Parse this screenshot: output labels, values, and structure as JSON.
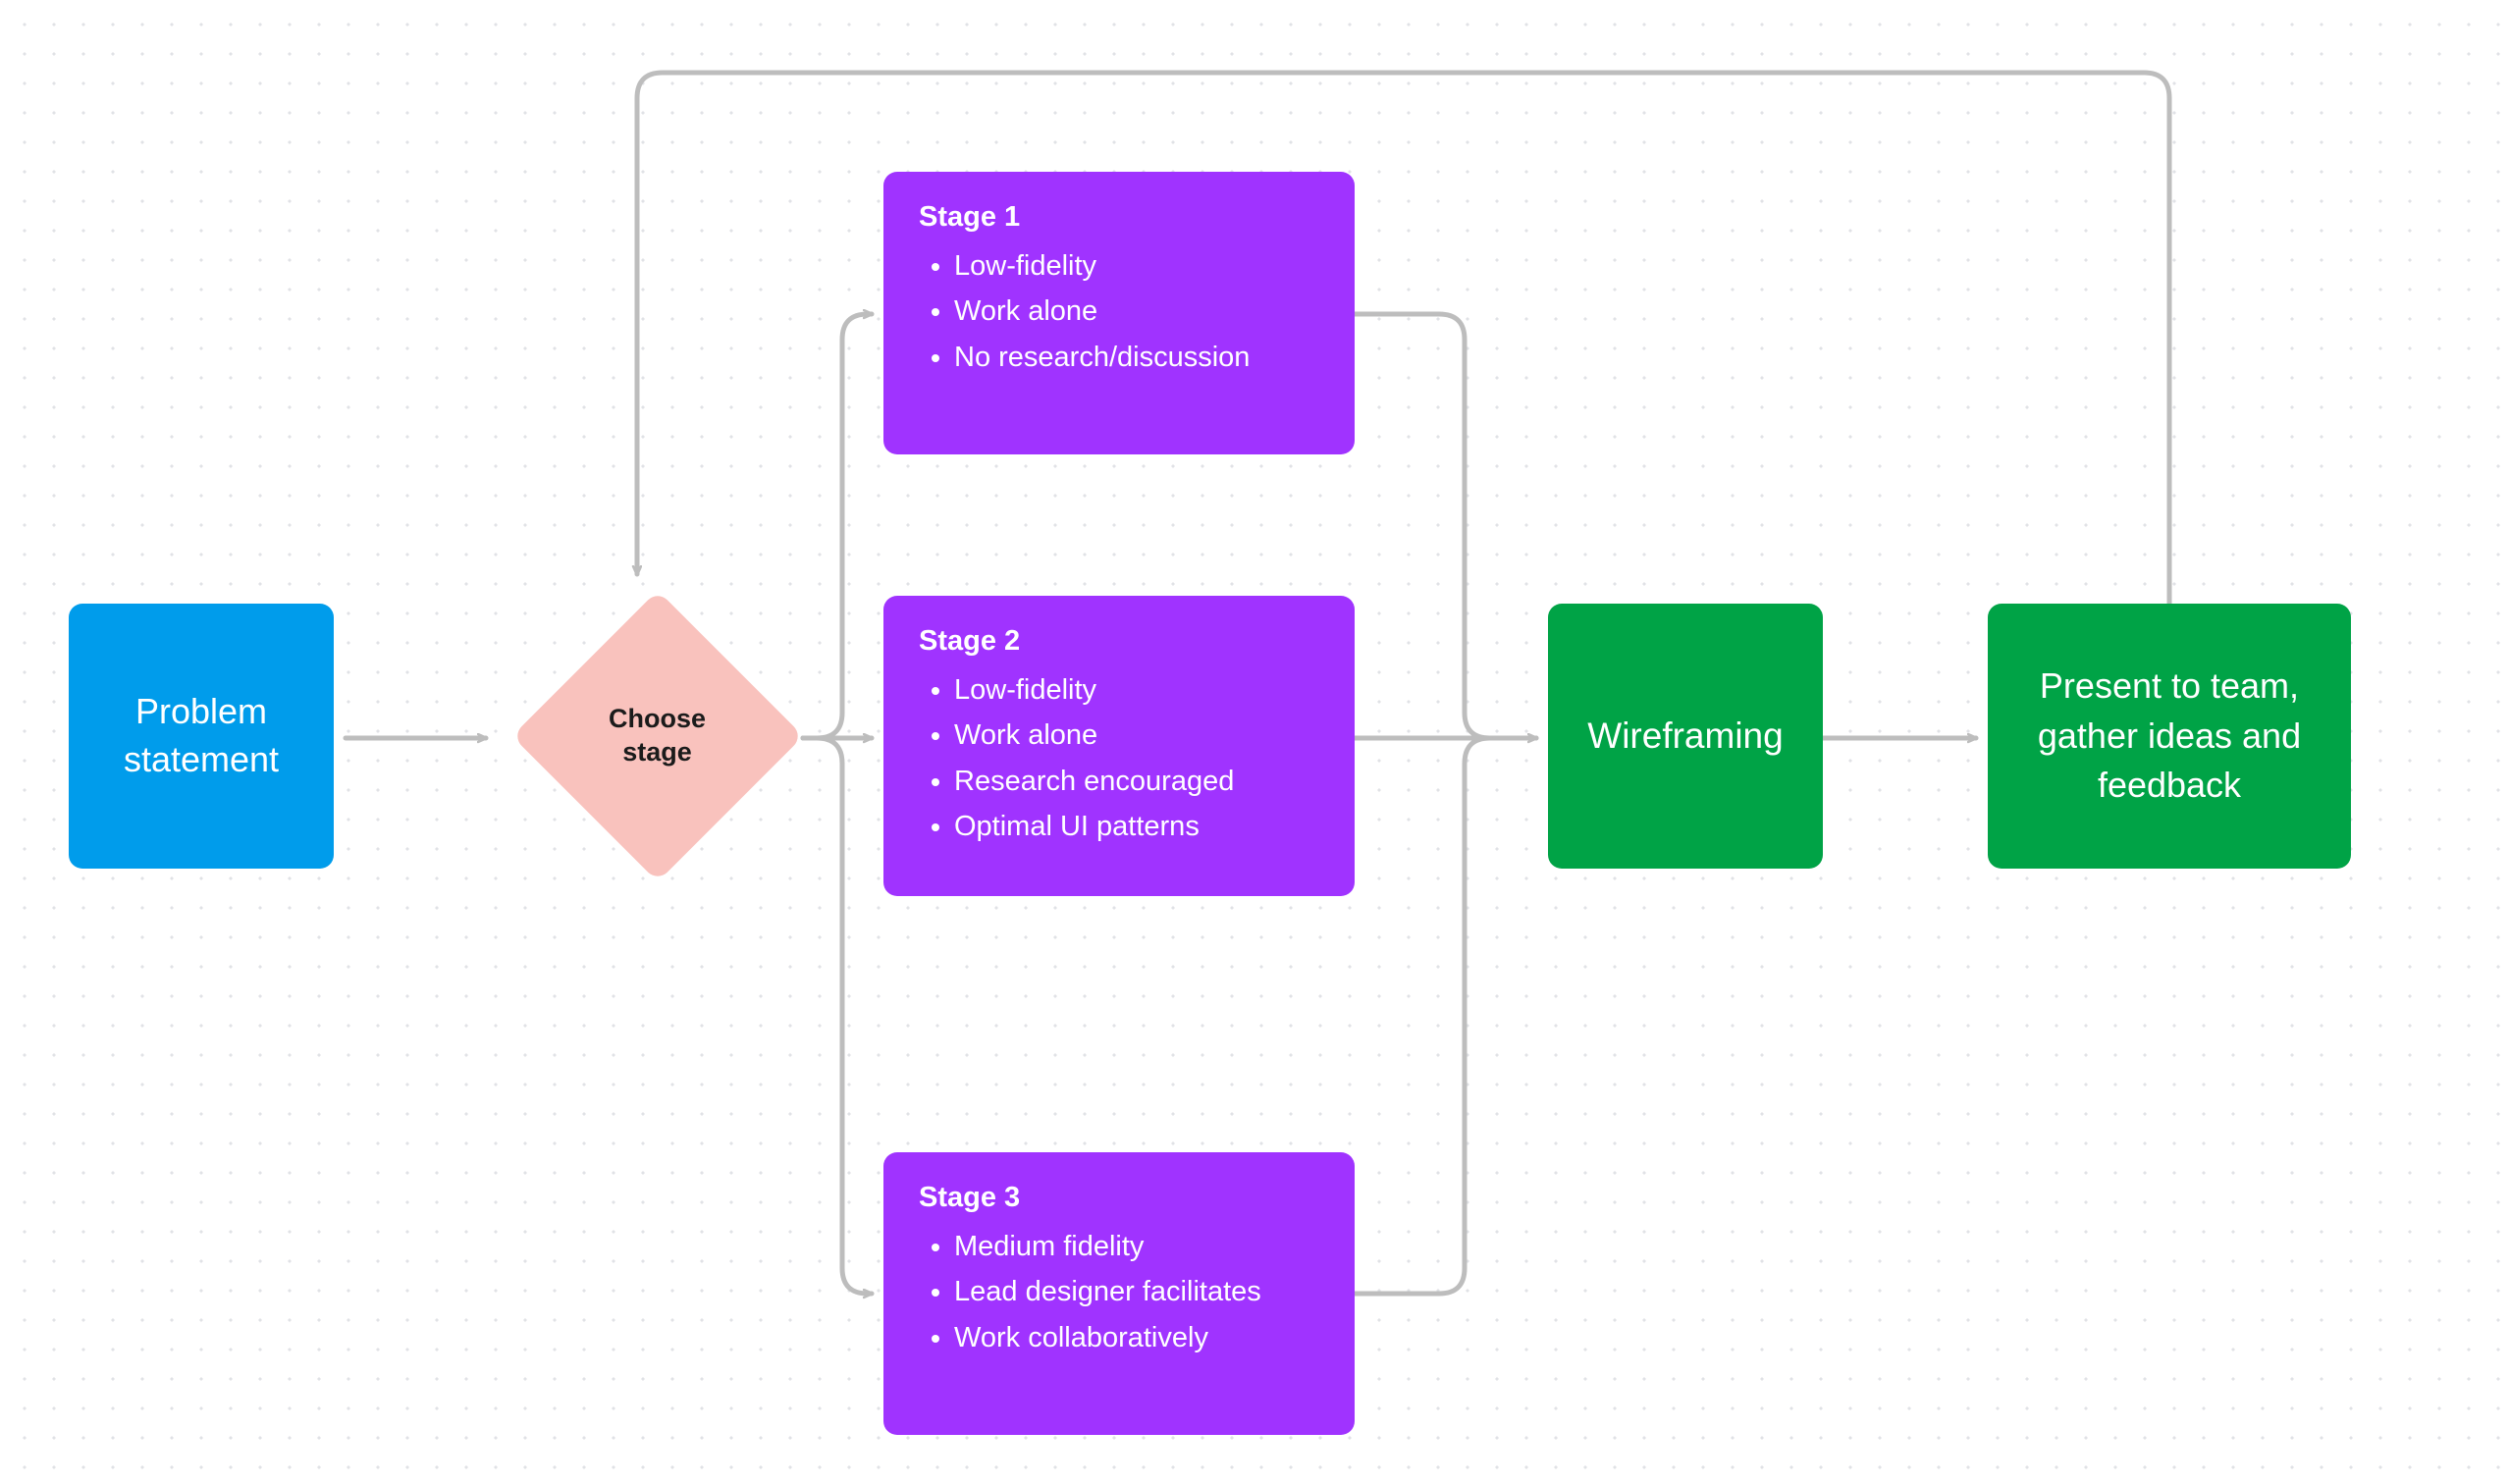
{
  "nodes": {
    "problem": "Problem statement",
    "choose": "Choose stage",
    "wireframing": "Wireframing",
    "present": "Present to team, gather ideas and feedback"
  },
  "stages": [
    {
      "title": "Stage 1",
      "bullets": [
        "Low-fidelity",
        "Work alone",
        "No research/discussion"
      ]
    },
    {
      "title": "Stage 2",
      "bullets": [
        "Low-fidelity",
        "Work alone",
        "Research encouraged",
        "Optimal UI patterns"
      ]
    },
    {
      "title": "Stage 3",
      "bullets": [
        "Medium fidelity",
        "Lead designer facilitates",
        "Work collaboratively"
      ]
    }
  ],
  "colors": {
    "blue": "#009CEB",
    "pink": "#F9C2BD",
    "purple": "#A033FF",
    "green": "#00A346",
    "arrow": "#BDBDBD"
  }
}
